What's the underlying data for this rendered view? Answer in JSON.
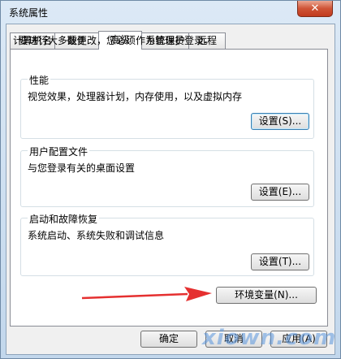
{
  "window": {
    "title": "系统属性",
    "close_label": "✕"
  },
  "tabs": [
    {
      "label": "计算机名",
      "active": false
    },
    {
      "label": "硬件",
      "active": false
    },
    {
      "label": "高级",
      "active": true
    },
    {
      "label": "系统保护",
      "active": false
    },
    {
      "label": "远程",
      "active": false
    }
  ],
  "admin_note": "要进行大多数更改，您必须作为管理员登录。",
  "groups": {
    "performance": {
      "title": "性能",
      "desc": "视觉效果，处理器计划，内存使用，以及虚拟内存",
      "button": "设置(S)..."
    },
    "profiles": {
      "title": "用户配置文件",
      "desc": "与您登录有关的桌面设置",
      "button": "设置(E)..."
    },
    "startup": {
      "title": "启动和故障恢复",
      "desc": "系统启动、系统失败和调试信息",
      "button": "设置(T)..."
    }
  },
  "env_button": "环境变量(N)...",
  "footer": {
    "ok": "确定",
    "cancel": "取消",
    "apply": "应用(A)"
  },
  "watermark": "xiown.com",
  "colors": {
    "arrow": "#e53030",
    "close": "#c13a1e"
  }
}
